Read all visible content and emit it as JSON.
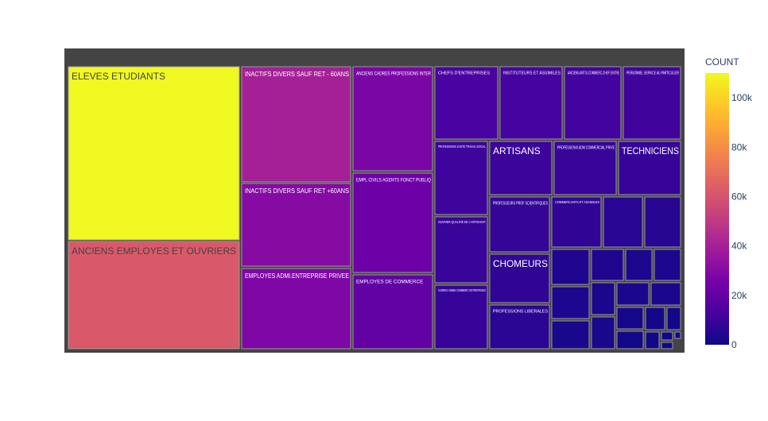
{
  "chart_data": {
    "type": "treemap",
    "title": "",
    "colorbar": {
      "title": "COUNT",
      "range": [
        0,
        110000
      ],
      "ticks": [
        {
          "value": 0,
          "label": "0"
        },
        {
          "value": 20000,
          "label": "20k"
        },
        {
          "value": 40000,
          "label": "40k"
        },
        {
          "value": 60000,
          "label": "60k"
        },
        {
          "value": 80000,
          "label": "80k"
        },
        {
          "value": 100000,
          "label": "100k"
        }
      ],
      "colorscale": [
        "#0d0887",
        "#46039f",
        "#7201a8",
        "#9c179e",
        "#bd3786",
        "#d8576b",
        "#ed7953",
        "#fb9f3a",
        "#fdca26",
        "#f0f921"
      ]
    },
    "tiles": [
      {
        "label": "ELEVES ETUDIANTS",
        "count": 110000
      },
      {
        "label": "ANCIENS EMPLOYES ET OUVRIERS",
        "count": 62000
      },
      {
        "label": "INACTIFS DIVERS SAUF RET - 60ANS",
        "count": 40000
      },
      {
        "label": "INACTIFS DIVERS SAUF RET +60ANS",
        "count": 30000
      },
      {
        "label": "EMPLOYES ADMI.ENTREPRISE PRIVEE",
        "count": 28000
      },
      {
        "label": "ANCIENS CADRES PROFESSIONS INTER",
        "count": 27000
      },
      {
        "label": "EMPL CIVILS AGENTS FONCT PUBLIQ",
        "count": 23000
      },
      {
        "label": "EMPLOYES DE COMMERCE",
        "count": 20000
      },
      {
        "label": "CHEFS D'ENTREPRISES",
        "count": 13000
      },
      {
        "label": "INSTITUTEURS ET ASSIMILES",
        "count": 12500
      },
      {
        "label": "ANCIENS ARTIS.COMMERC.CHEF ENTRE",
        "count": 11500
      },
      {
        "label": "PERSONNEL SERVICE AU PARTICULIER",
        "count": 11000
      },
      {
        "label": "PROFESSIONS SANTE TRAVAIL SOCIAL",
        "count": 10500
      },
      {
        "label": "OUVRIER QUALIFIE DE L'ARTISANAT",
        "count": 9500
      },
      {
        "label": "CADRES ADMIN COMMERC ENTREPRISES",
        "count": 9000
      },
      {
        "label": "ARTISANS",
        "count": 10000
      },
      {
        "label": "PROFESSIONS ADM COMMERCIAL PRIVE",
        "count": 9500
      },
      {
        "label": "TECHNICIENS",
        "count": 9000
      },
      {
        "label": "PROFESSEURS PROF SCIENTIFIQUES",
        "count": 8500
      },
      {
        "label": "COMMERCANTS ET ASSIMILES",
        "count": 7500
      },
      {
        "label": "",
        "count": 6000
      },
      {
        "label": "",
        "count": 5500
      },
      {
        "label": "CHOMEURS",
        "count": 7500
      },
      {
        "label": "PROFESSIONS LIBERALES",
        "count": 6500
      },
      {
        "label": "",
        "count": 4000
      },
      {
        "label": "",
        "count": 4000
      },
      {
        "label": "",
        "count": 3500
      },
      {
        "label": "",
        "count": 3500
      },
      {
        "label": "",
        "count": 3500
      },
      {
        "label": "",
        "count": 2500
      },
      {
        "label": "",
        "count": 3000
      },
      {
        "label": "",
        "count": 3000
      },
      {
        "label": "",
        "count": 2500
      },
      {
        "label": "",
        "count": 2500
      },
      {
        "label": "",
        "count": 2000
      },
      {
        "label": "",
        "count": 1500
      },
      {
        "label": "",
        "count": 1500
      },
      {
        "label": "",
        "count": 1000
      },
      {
        "label": "",
        "count": 800
      },
      {
        "label": "",
        "count": 500
      },
      {
        "label": "",
        "count": 500
      },
      {
        "label": "",
        "count": 300
      }
    ]
  }
}
